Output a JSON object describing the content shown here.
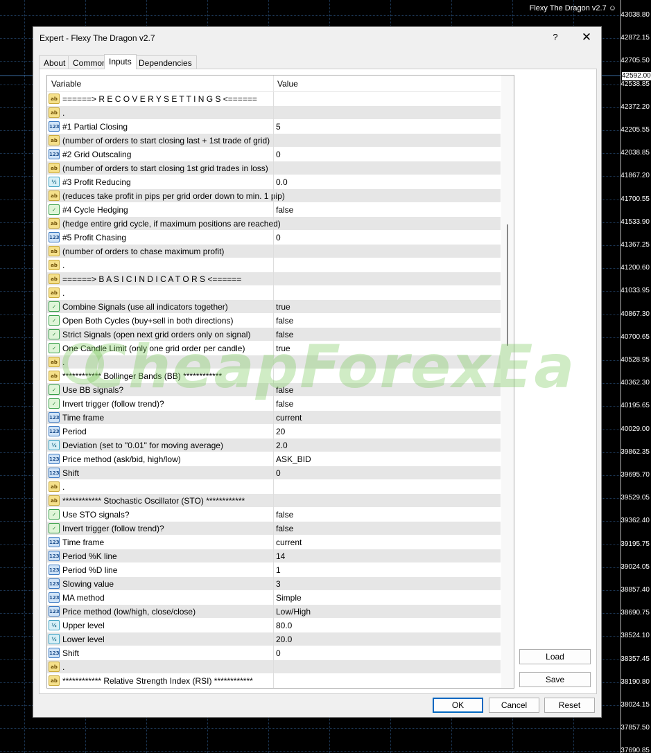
{
  "chart": {
    "title": "Flexy The Dragon v2.7 ☺",
    "current_price": "42592.00",
    "prices": [
      "43038.80",
      "42872.15",
      "42705.50",
      "42538.85",
      "42372.20",
      "42205.55",
      "42038.85",
      "41867.20",
      "41700.55",
      "41533.90",
      "41367.25",
      "41200.60",
      "41033.95",
      "40867.30",
      "40700.65",
      "40528.95",
      "40362.30",
      "40195.65",
      "40029.00",
      "39862.35",
      "39695.70",
      "39529.05",
      "39362.40",
      "39195.75",
      "39024.05",
      "38857.40",
      "38690.75",
      "38524.10",
      "38357.45",
      "38190.80",
      "38024.15",
      "37857.50",
      "37690.85"
    ]
  },
  "dialog": {
    "title": "Expert - Flexy The Dragon v2.7",
    "help": "?",
    "close": "✕",
    "tabs": [
      "About",
      "Common",
      "Inputs",
      "Dependencies"
    ],
    "active_tab": "Inputs",
    "columns": {
      "variable": "Variable",
      "value": "Value"
    },
    "rows": [
      {
        "type": "ab",
        "var": "======> R E C O V E R Y   S E T T I N G S <======",
        "val": ""
      },
      {
        "type": "ab",
        "var": ".",
        "val": ""
      },
      {
        "type": "n123",
        "var": "#1 Partial Closing",
        "val": "5"
      },
      {
        "type": "ab",
        "var": "(number of orders to start closing last + 1st trade of grid)",
        "val": ""
      },
      {
        "type": "n123",
        "var": "#2 Grid Outscaling",
        "val": "0"
      },
      {
        "type": "ab",
        "var": "(number of orders to start closing 1st grid trades in loss)",
        "val": ""
      },
      {
        "type": "half",
        "var": "#3 Profit Reducing",
        "val": "0.0"
      },
      {
        "type": "ab",
        "var": "(reduces take profit in pips per grid order down to min. 1 pip)",
        "val": ""
      },
      {
        "type": "bool",
        "var": "#4 Cycle Hedging",
        "val": "false"
      },
      {
        "type": "ab",
        "var": "(hedge entire grid cycle, if maximum positions are reached)",
        "val": ""
      },
      {
        "type": "n123",
        "var": "#5 Profit Chasing",
        "val": "0"
      },
      {
        "type": "ab",
        "var": "(number of orders to chase maximum profit)",
        "val": ""
      },
      {
        "type": "ab",
        "var": ".",
        "val": ""
      },
      {
        "type": "ab",
        "var": "======> B A S I C   I N D I C A T O R S <======",
        "val": ""
      },
      {
        "type": "ab",
        "var": ".",
        "val": ""
      },
      {
        "type": "bool",
        "var": "Combine Signals (use all indicators together)",
        "val": "true"
      },
      {
        "type": "bool",
        "var": "Open Both Cycles (buy+sell in both directions)",
        "val": "false"
      },
      {
        "type": "bool",
        "var": "Strict Signals (open next grid orders only on signal)",
        "val": "false"
      },
      {
        "type": "bool",
        "var": "One Candle Limit (only one grid order per candle)",
        "val": "true"
      },
      {
        "type": "ab",
        "var": ".",
        "val": ""
      },
      {
        "type": "ab",
        "var": "************  Bollinger Bands (BB)  ************",
        "val": ""
      },
      {
        "type": "bool",
        "var": "Use BB signals?",
        "val": "false"
      },
      {
        "type": "bool",
        "var": "Invert trigger (follow trend)?",
        "val": "false"
      },
      {
        "type": "n123",
        "var": "Time frame",
        "val": "current"
      },
      {
        "type": "n123",
        "var": "Period",
        "val": "20"
      },
      {
        "type": "half",
        "var": "Deviation (set to \"0.01\" for moving average)",
        "val": "2.0"
      },
      {
        "type": "n123",
        "var": "Price method (ask/bid, high/low)",
        "val": "ASK_BID"
      },
      {
        "type": "n123",
        "var": "Shift",
        "val": "0"
      },
      {
        "type": "ab",
        "var": ".",
        "val": ""
      },
      {
        "type": "ab",
        "var": "************  Stochastic Oscillator (STO)  ************",
        "val": ""
      },
      {
        "type": "bool",
        "var": "Use STO signals?",
        "val": "false"
      },
      {
        "type": "bool",
        "var": "Invert trigger (follow trend)?",
        "val": "false"
      },
      {
        "type": "n123",
        "var": "Time frame",
        "val": "current"
      },
      {
        "type": "n123",
        "var": "Period %K line",
        "val": "14"
      },
      {
        "type": "n123",
        "var": "Period %D line",
        "val": "1"
      },
      {
        "type": "n123",
        "var": "Slowing value",
        "val": "3"
      },
      {
        "type": "n123",
        "var": "MA method",
        "val": "Simple"
      },
      {
        "type": "n123",
        "var": "Price method (low/high, close/close)",
        "val": "Low/High"
      },
      {
        "type": "half",
        "var": "Upper level",
        "val": "80.0"
      },
      {
        "type": "half",
        "var": "Lower level",
        "val": "20.0"
      },
      {
        "type": "n123",
        "var": "Shift",
        "val": "0"
      },
      {
        "type": "ab",
        "var": ".",
        "val": ""
      },
      {
        "type": "ab",
        "var": "************  Relative Strength Index (RSI)  ************",
        "val": ""
      }
    ],
    "side_buttons": {
      "load": "Load",
      "save": "Save"
    },
    "footer_buttons": {
      "ok": "OK",
      "cancel": "Cancel",
      "reset": "Reset"
    }
  },
  "icons": {
    "ab": "string-type-icon",
    "n123": "integer-type-icon",
    "half": "double-type-icon",
    "bool": "bool-type-icon"
  },
  "watermark": "CheapForexEa"
}
